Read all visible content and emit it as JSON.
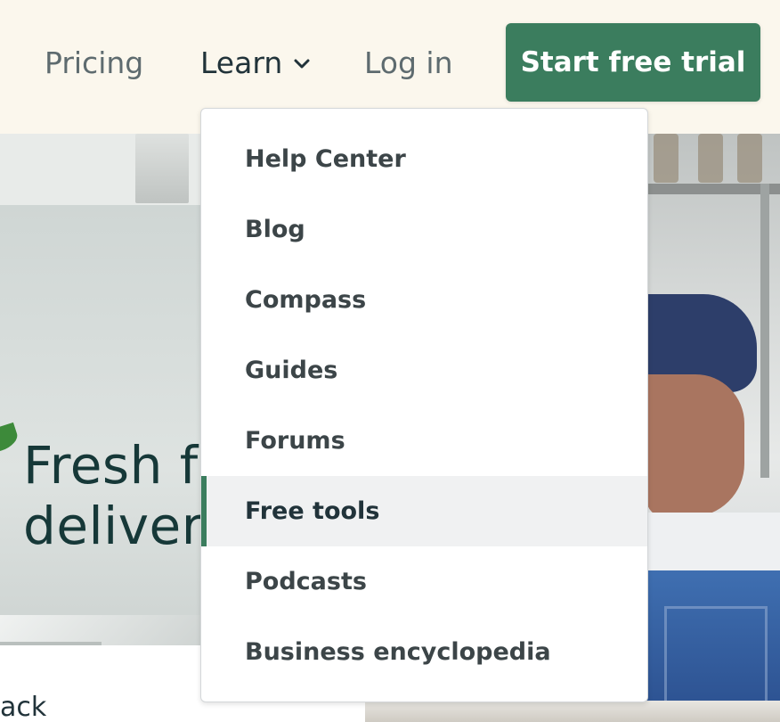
{
  "header": {
    "nav": {
      "pricing": "Pricing",
      "learn": "Learn",
      "login": "Log in"
    },
    "cta": "Start free trial"
  },
  "learn_menu": {
    "items": [
      {
        "label": "Help Center",
        "active": false
      },
      {
        "label": "Blog",
        "active": false
      },
      {
        "label": "Compass",
        "active": false
      },
      {
        "label": "Guides",
        "active": false
      },
      {
        "label": "Forums",
        "active": false
      },
      {
        "label": "Free tools",
        "active": true
      },
      {
        "label": "Podcasts",
        "active": false
      },
      {
        "label": "Business encyclopedia",
        "active": false
      }
    ]
  },
  "hero": {
    "headline": "Fresh fo\ndelivere",
    "partial_text": "ack"
  },
  "colors": {
    "accent": "#3b7d5e",
    "header_bg": "#fbf7ed",
    "active_item_bg": "#f0f1f2"
  },
  "icons": {
    "learn_dropdown": "chevron-down-icon"
  }
}
